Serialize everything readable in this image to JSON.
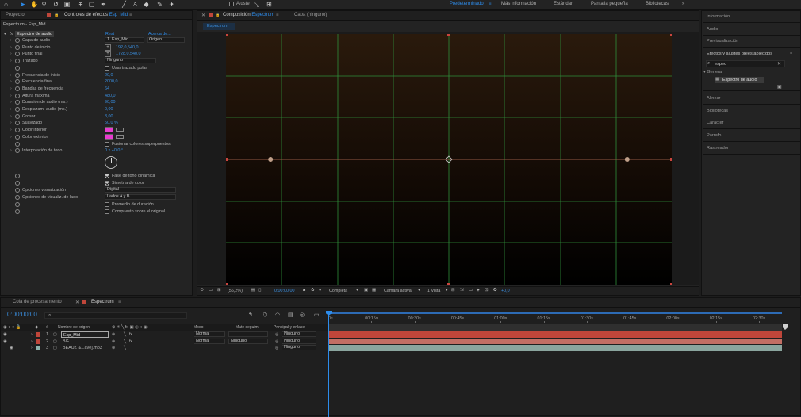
{
  "toolbar": {
    "snap_label": "Ajuste"
  },
  "workspaces": {
    "items": [
      "Predeterminado",
      "Más información",
      "Estándar",
      "Pantalla pequeña",
      "Bibliotecas"
    ],
    "active": "Predeterminado",
    "more": "»"
  },
  "left_panel": {
    "tab_project": "Proyecto",
    "tab_effects_prefix": "Controles de efectos",
    "tab_effects_layer": "Esp_Mid",
    "breadcrumb": "Espectrum - Esp_Mid",
    "effect": {
      "fx": "fx",
      "name": "Espectro de audio",
      "reset": "Rest",
      "about": "Acerca de..."
    },
    "props": [
      {
        "label": "Capa de audio",
        "kind": "dd2",
        "v1": "1. Esp_Mid",
        "v2": "Origen"
      },
      {
        "label": "Punto de inicio",
        "kind": "point",
        "value": "192,0,540,0"
      },
      {
        "label": "Punto final",
        "kind": "point",
        "value": "1728,0,540,0"
      },
      {
        "label": "Trazado",
        "kind": "dd",
        "value": "Ninguno"
      },
      {
        "label": "",
        "kind": "check",
        "checked": false,
        "text": "Usar trazado polar"
      },
      {
        "label": "Frecuencia de inicio",
        "kind": "num",
        "value": "20,0"
      },
      {
        "label": "Frecuencia final",
        "kind": "num",
        "value": "2000,0"
      },
      {
        "label": "Bandas de frecuencia",
        "kind": "num",
        "value": "64"
      },
      {
        "label": "Altura máxima",
        "kind": "num",
        "value": "480,0"
      },
      {
        "label": "Duración de audio (ms.)",
        "kind": "num",
        "value": "90,00"
      },
      {
        "label": "Desplazam. audio (ms.)",
        "kind": "num",
        "value": "0,00"
      },
      {
        "label": "Grosor",
        "kind": "num",
        "value": "3,00"
      },
      {
        "label": "Suavizado",
        "kind": "num",
        "value": "50,0 %"
      },
      {
        "label": "Color interior",
        "kind": "color",
        "color": "#e83ccf"
      },
      {
        "label": "Color exterior",
        "kind": "color",
        "color": "#e83ccf"
      },
      {
        "label": "",
        "kind": "check",
        "checked": false,
        "text": "Fusionar colores superpuestos"
      },
      {
        "label": "Interpolación de tono",
        "kind": "num",
        "value": "0 x +0,0 °"
      }
    ],
    "props2": [
      {
        "kind": "check",
        "checked": true,
        "text": "Fase de tono dinámica"
      },
      {
        "kind": "check",
        "checked": true,
        "text": "Simetría de color"
      },
      {
        "label": "Opciones visualización",
        "kind": "dd",
        "value": "Digital"
      },
      {
        "label": "Opciones de visualiz. de lado",
        "kind": "dd",
        "value": "Lados A y B"
      },
      {
        "kind": "check",
        "checked": false,
        "text": "Promedio de duración"
      },
      {
        "kind": "check",
        "checked": false,
        "text": "Compuesto sobre el original"
      }
    ]
  },
  "comp_panel": {
    "tab_prefix": "Composición",
    "tab_name": "Espectrum",
    "tab_layer": "Capa (ninguno)",
    "sub_tab": "Espectrum",
    "footer": {
      "zoom": "(56,2%)",
      "time": "0:00:00:00",
      "quality": "Completa",
      "camera": "Cámara activa",
      "views": "1 Vista",
      "exposure": "+0,0"
    }
  },
  "right_panel": {
    "top_items": [
      "Información",
      "Audio",
      "Previsualización"
    ],
    "search_title": "Efectos y ajustes preestablecidos",
    "search_value": "espec",
    "tree_group": "Generar",
    "tree_item": "Espectro de audio",
    "bottom_items": [
      "Alinear",
      "Bibliotecas",
      "Carácter",
      "Párrafo",
      "Rastreador"
    ]
  },
  "timeline": {
    "tab_queue": "Cola de procesamiento",
    "tab_comp": "Espectrum",
    "timecode": "0:00:00:00",
    "columns": {
      "num": "#",
      "source": "Nombre de origen",
      "mode": "Modo",
      "matte": "Mate seguim.",
      "parent": "Principal y enlace"
    },
    "layers": [
      {
        "num": "1",
        "name": "Esp_Mid",
        "mode": "Normal",
        "matte": "",
        "parent": "Ninguno",
        "color": "#c0463a",
        "bar": "#c0463a",
        "selected": true
      },
      {
        "num": "2",
        "name": "BG",
        "mode": "Normal",
        "matte": "Ninguno",
        "parent": "Ninguno",
        "color": "#c0463a",
        "bar": "#c26e64",
        "selected": false
      },
      {
        "num": "3",
        "name": "BEAUZ &...ave].mp3",
        "mode": "",
        "matte": "",
        "parent": "Ninguno",
        "color": "#8fb4ad",
        "bar": "#8aa59e",
        "selected": false
      }
    ],
    "ruler": [
      "0s",
      "00:15s",
      "00:30s",
      "00:45s",
      "01:00s",
      "01:15s",
      "01:30s",
      "01:45s",
      "02:00s",
      "02:15s",
      "02:30s"
    ]
  }
}
